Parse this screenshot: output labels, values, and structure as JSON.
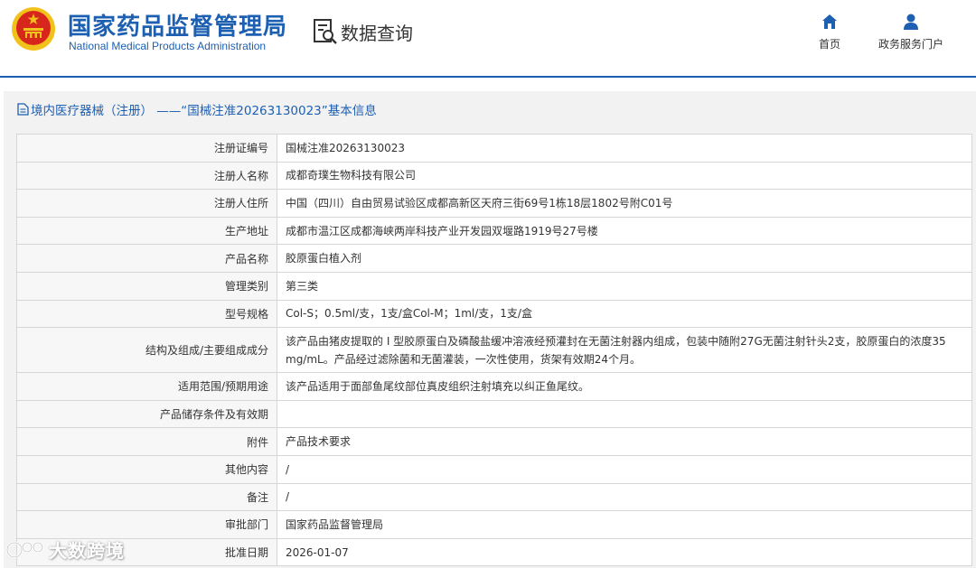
{
  "header": {
    "brand_cn": "国家药品监督管理局",
    "brand_en": "National Medical Products Administration",
    "data_query": "数据查询",
    "nav_home": "首页",
    "nav_portal": "政务服务门户"
  },
  "panel": {
    "title": "境内医疗器械（注册） ——“国械注准20263130023”基本信息"
  },
  "rows": [
    {
      "label": "注册证编号",
      "value": "国械注准20263130023"
    },
    {
      "label": "注册人名称",
      "value": "成都奇璞生物科技有限公司"
    },
    {
      "label": "注册人住所",
      "value": "中国（四川）自由贸易试验区成都高新区天府三街69号1栋18层1802号附C01号"
    },
    {
      "label": "生产地址",
      "value": "成都市温江区成都海峡两岸科技产业开发园双堰路1919号27号楼"
    },
    {
      "label": "产品名称",
      "value": "胶原蛋白植入剂"
    },
    {
      "label": "管理类别",
      "value": "第三类"
    },
    {
      "label": "型号规格",
      "value": "Col-S；0.5ml/支，1支/盒Col-M；1ml/支，1支/盒"
    },
    {
      "label": "结构及组成/主要组成成分",
      "value": "该产品由猪皮提取的 I 型胶原蛋白及磷酸盐缓冲溶液经预灌封在无菌注射器内组成，包装中随附27G无菌注射针头2支，胶原蛋白的浓度35 mg/mL。产品经过滤除菌和无菌灌装，一次性使用，货架有效期24个月。"
    },
    {
      "label": "适用范围/预期用途",
      "value": "该产品适用于面部鱼尾纹部位真皮组织注射填充以纠正鱼尾纹。"
    },
    {
      "label": "产品储存条件及有效期",
      "value": ""
    },
    {
      "label": "附件",
      "value": "产品技术要求"
    },
    {
      "label": "其他内容",
      "value": "/"
    },
    {
      "label": "备注",
      "value": "/"
    },
    {
      "label": "审批部门",
      "value": "国家药品监督管理局"
    },
    {
      "label": "批准日期",
      "value": "2026-01-07"
    }
  ],
  "watermark": {
    "text": "大数跨境"
  },
  "colors": {
    "brand_blue": "#1d5fb1",
    "emblem_red": "#d7261b",
    "emblem_gold": "#f2c21c"
  }
}
